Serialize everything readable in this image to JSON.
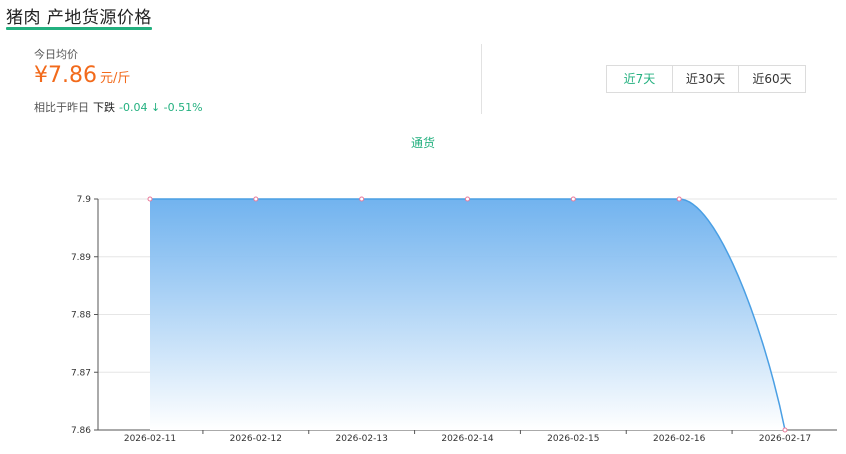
{
  "header": {
    "title": "猪肉 产地货源价格"
  },
  "summary": {
    "today_label": "今日均价",
    "price": "¥7.86",
    "unit": "元/斤",
    "compare_label": "相比于昨日",
    "trend_word": "下跌",
    "change_text": "-0.04 ↓ -0.51%"
  },
  "range_tabs": [
    {
      "label": "近7天",
      "active": true
    },
    {
      "label": "近30天",
      "active": false
    },
    {
      "label": "近60天",
      "active": false
    }
  ],
  "colors": {
    "accent": "#23b07f",
    "price": "#f26a1b",
    "series_line": "#4a9fe4",
    "area_top": "#6aafee",
    "point_stroke": "#e8799a"
  },
  "chart_data": {
    "type": "area",
    "title": "",
    "xlabel": "",
    "ylabel": "",
    "x": [
      "2026-02-11",
      "2026-02-12",
      "2026-02-13",
      "2026-02-14",
      "2026-02-15",
      "2026-02-16",
      "2026-02-17"
    ],
    "series": [
      {
        "name": "通货",
        "values": [
          7.9,
          7.9,
          7.9,
          7.9,
          7.9,
          7.9,
          7.86
        ]
      }
    ],
    "ylim": [
      7.86,
      7.9
    ],
    "yticks": [
      "7.9",
      "7.89",
      "7.88",
      "7.87",
      "7.86"
    ],
    "grid": true,
    "legend": "top-center",
    "smooth": true
  }
}
